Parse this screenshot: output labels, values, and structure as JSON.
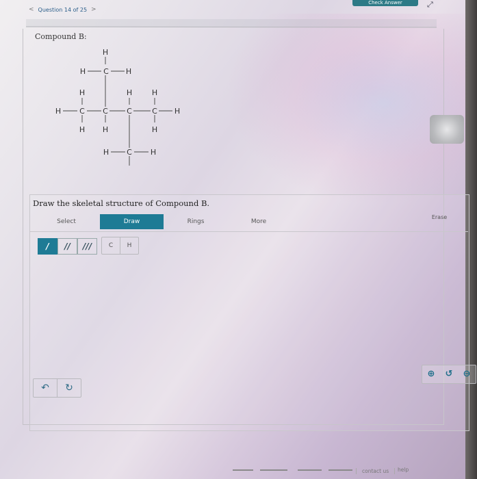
{
  "header": {
    "prev_arrow": "<",
    "question_label": "Question 14 of 25",
    "next_arrow": ">",
    "check_answer": "Check Answer",
    "expand_icon": "expand-icon"
  },
  "question": {
    "compound_label": "Compound B:",
    "prompt": "Draw the skeletal structure of Compound B."
  },
  "molecule": {
    "atoms": [
      "H",
      "H",
      "C",
      "H",
      "H",
      "H",
      "H",
      "H",
      "C",
      "C",
      "C",
      "C",
      "H",
      "H",
      "H",
      "H",
      "C",
      "H",
      "H"
    ]
  },
  "toolbar": {
    "select": "Select",
    "draw": "Draw",
    "rings": "Rings",
    "more": "More",
    "erase": "Erase"
  },
  "bonds": {
    "single": "/",
    "double": "//",
    "triple": "///"
  },
  "atoms": {
    "carbon": "C",
    "hydrogen": "H"
  },
  "footer": {
    "contact": "contact us",
    "help": "help"
  },
  "colors": {
    "accent": "#1e7b95",
    "check_button": "#2d7a86"
  }
}
